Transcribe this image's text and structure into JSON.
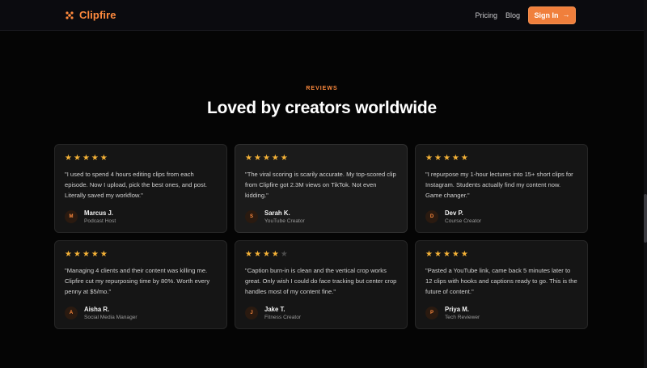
{
  "header": {
    "brand": "Clipfire",
    "nav": [
      "Pricing",
      "Blog"
    ],
    "signin": "Sign In"
  },
  "section": {
    "eyebrow": "REVIEWS",
    "title": "Loved by creators worldwide"
  },
  "reviews": [
    {
      "rating": 5,
      "quote": "\"I used to spend 4 hours editing clips from each episode. Now I upload, pick the best ones, and post. Literally saved my workflow.\"",
      "initial": "M",
      "name": "Marcus J.",
      "role": "Podcast Host"
    },
    {
      "rating": 5,
      "quote": "\"The viral scoring is scarily accurate. My top-scored clip from Clipfire got 2.3M views on TikTok. Not even kidding.\"",
      "initial": "S",
      "name": "Sarah K.",
      "role": "YouTube Creator"
    },
    {
      "rating": 5,
      "quote": "\"I repurpose my 1-hour lectures into 15+ short clips for Instagram. Students actually find my content now. Game changer.\"",
      "initial": "D",
      "name": "Dev P.",
      "role": "Course Creator"
    },
    {
      "rating": 5,
      "quote": "\"Managing 4 clients and their content was killing me. Clipfire cut my repurposing time by 80%. Worth every penny at $5/mo.\"",
      "initial": "A",
      "name": "Aisha R.",
      "role": "Social Media Manager"
    },
    {
      "rating": 4,
      "quote": "\"Caption burn-in is clean and the vertical crop works great. Only wish I could do face tracking but center crop handles most of my content fine.\"",
      "initial": "J",
      "name": "Jake T.",
      "role": "Fitness Creator"
    },
    {
      "rating": 5,
      "quote": "\"Pasted a YouTube link, came back 5 minutes later to 12 clips with hooks and captions ready to go. This is the future of content.\"",
      "initial": "P",
      "name": "Priya M.",
      "role": "Tech Reviewer"
    }
  ],
  "colors": {
    "accent": "#ff8a3d",
    "button": "#f07f3c",
    "star": "#f5b237"
  }
}
